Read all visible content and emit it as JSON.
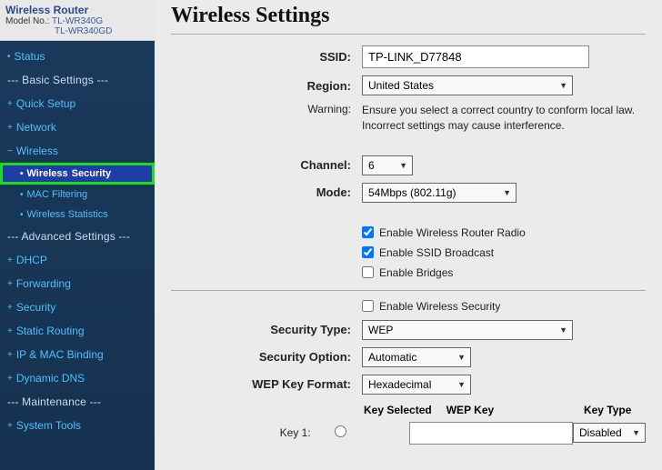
{
  "sidebar": {
    "header": {
      "router_name": "Wireless Router",
      "model_label": "Model No.:",
      "model1": "TL-WR340G",
      "model2": "TL-WR340GD"
    },
    "items": {
      "status": "Status",
      "basic_settings": "--- Basic Settings ---",
      "quick_setup": "Quick Setup",
      "network": "Network",
      "wireless": "Wireless",
      "wireless_security_a": "Wireless",
      "wireless_security_b": "Security",
      "mac_filtering": "MAC Filtering",
      "wireless_stats": "Wireless Statistics",
      "advanced_settings": "--- Advanced Settings ---",
      "dhcp": "DHCP",
      "forwarding": "Forwarding",
      "security": "Security",
      "static_routing": "Static Routing",
      "ip_mac_binding": "IP & MAC Binding",
      "dynamic_dns": "Dynamic DNS",
      "maintenance": "--- Maintenance ---",
      "system_tools": "System Tools"
    }
  },
  "page": {
    "title": "Wireless Settings",
    "labels": {
      "ssid": "SSID:",
      "region": "Region:",
      "warning": "Warning:",
      "channel": "Channel:",
      "mode": "Mode:",
      "security_type": "Security Type:",
      "security_option": "Security Option:",
      "wep_key_format": "WEP Key Format:",
      "key1": "Key 1:"
    },
    "fields": {
      "ssid_value": "TP-LINK_D77848",
      "region_value": "United States",
      "warning_text": "Ensure you select a correct country to conform local law. Incorrect settings may cause interference.",
      "channel_value": "6",
      "mode_value": "54Mbps (802.11g)",
      "enable_radio": "Enable Wireless Router Radio",
      "enable_ssid": "Enable SSID Broadcast",
      "enable_bridges": "Enable Bridges",
      "enable_security": "Enable Wireless Security",
      "security_type_value": "WEP",
      "security_option_value": "Automatic",
      "wep_key_format_value": "Hexadecimal",
      "key_selected_header": "Key Selected",
      "wep_key_header": "WEP Key",
      "key_type_header": "Key Type",
      "key_type_value": "Disabled"
    },
    "checked": {
      "radio": true,
      "ssid": true,
      "bridges": false,
      "security": false
    }
  }
}
